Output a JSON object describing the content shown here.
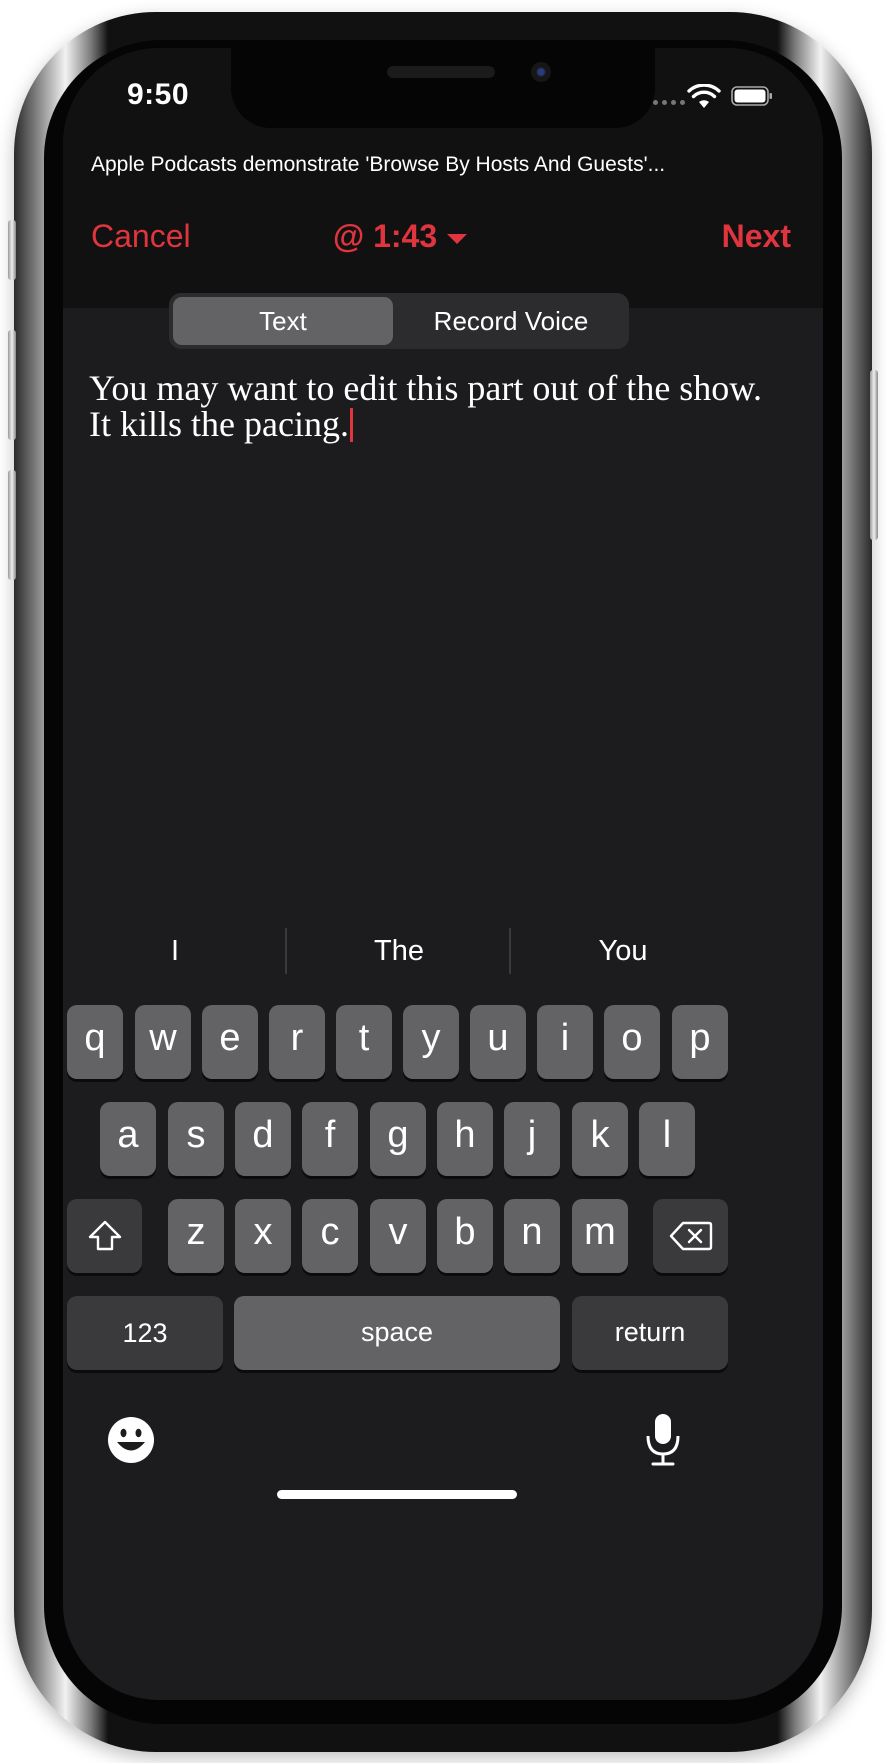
{
  "status_bar": {
    "time": "9:50",
    "icons": [
      "cellular-signal-icon",
      "wifi-icon",
      "battery-icon"
    ]
  },
  "episode": {
    "title": "Apple Podcasts demonstrate 'Browse By Hosts And Guests'..."
  },
  "nav": {
    "cancel_label": "Cancel",
    "timestamp": "@ 1:43",
    "next_label": "Next"
  },
  "segmented_control": {
    "options": [
      "Text",
      "Record Voice"
    ],
    "selected": "Text"
  },
  "compose": {
    "text": "You may want to edit this part out of the show. It kills the pacing."
  },
  "keyboard": {
    "suggestions": [
      "I",
      "The",
      "You"
    ],
    "row1": [
      "q",
      "w",
      "e",
      "r",
      "t",
      "y",
      "u",
      "i",
      "o",
      "p"
    ],
    "row2": [
      "a",
      "s",
      "d",
      "f",
      "g",
      "h",
      "j",
      "k",
      "l"
    ],
    "row3": [
      "z",
      "x",
      "c",
      "v",
      "b",
      "n",
      "m"
    ],
    "numbers_label": "123",
    "space_label": "space",
    "return_label": "return",
    "icons": [
      "shift-icon",
      "delete-icon",
      "emoji-icon",
      "microphone-icon"
    ]
  },
  "colors": {
    "accent": "#e0343f",
    "background": "#1c1c1e",
    "header": "#111111",
    "key": "#636366",
    "key_dark": "#3a3a3c"
  }
}
